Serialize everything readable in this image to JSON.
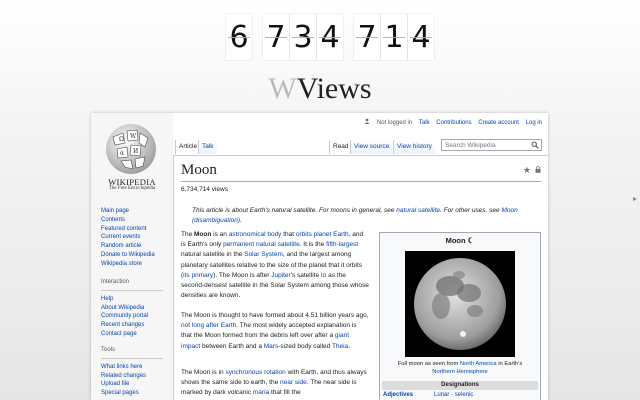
{
  "counter": {
    "digits": [
      "6",
      "7",
      "3",
      "4",
      "7",
      "1",
      "4"
    ]
  },
  "views_label_mark": "W",
  "views_label": "Views",
  "wiki": {
    "wordmark": "WIKIPEDIA",
    "tagline": "The Free Encyclopedia",
    "nav_main": [
      "Main page",
      "Contents",
      "Featured content",
      "Current events",
      "Random article",
      "Donate to Wikipedia",
      "Wikipedia store"
    ],
    "interaction_heading": "Interaction",
    "nav_interaction": [
      "Help",
      "About Wikipedia",
      "Community portal",
      "Recent changes",
      "Contact page"
    ],
    "tools_heading": "Tools",
    "nav_tools": [
      "What links here",
      "Related changes",
      "Upload file",
      "Special pages"
    ],
    "top_links": {
      "not_logged_in": "Not logged in",
      "talk": "Talk",
      "contributions": "Contributions",
      "create_account": "Create account",
      "log_in": "Log in"
    },
    "tabs": {
      "article": "Article",
      "talk": "Talk",
      "read": "Read",
      "view_source": "View source",
      "view_history": "View history"
    },
    "search_placeholder": "Search Wikipedia",
    "page_title": "Moon",
    "view_count": "6,734,714 views",
    "hatnote": {
      "prefix": "This article is about Earth's natural satellite. For moons in general, see ",
      "link1": "natural satellite",
      "middle": ". For other uses, see ",
      "link2": "Moon (disambiguation)",
      "suffix": "."
    },
    "para1": [
      {
        "t": "The "
      },
      {
        "t": "Moon",
        "b": true
      },
      {
        "t": " is an "
      },
      {
        "t": "astronomical body",
        "l": true
      },
      {
        "t": " that "
      },
      {
        "t": "orbits planet Earth",
        "l": true
      },
      {
        "t": ", and is Earth's only "
      },
      {
        "t": "permanent natural satellite",
        "l": true
      },
      {
        "t": ". It is the "
      },
      {
        "t": "fifth-largest",
        "l": true
      },
      {
        "t": " natural satellite in the "
      },
      {
        "t": "Solar System",
        "l": true
      },
      {
        "t": ", and the largest among planetary satellites relative to the size of the planet that it orbits ("
      },
      {
        "t": "its primary",
        "l": true
      },
      {
        "t": "). The Moon is after "
      },
      {
        "t": "Jupiter",
        "l": true
      },
      {
        "t": "'s satellite "
      },
      {
        "t": "Io",
        "l": true
      },
      {
        "t": " as the second-densest satellite in the Solar System among those whose densities are known."
      }
    ],
    "para2": [
      {
        "t": "The Moon is thought to have formed about 4.51 billion years ago, "
      },
      {
        "t": "not long after Earth",
        "l": true
      },
      {
        "t": ". The most widely accepted explanation is that the Moon formed from the debris left over after a "
      },
      {
        "t": "giant impact",
        "l": true
      },
      {
        "t": " between Earth and a "
      },
      {
        "t": "Mars",
        "l": true
      },
      {
        "t": "-sized body called "
      },
      {
        "t": "Theia",
        "l": true
      },
      {
        "t": "."
      }
    ],
    "para3": [
      {
        "t": "The Moon is in "
      },
      {
        "t": "synchronous rotation",
        "l": true
      },
      {
        "t": " with Earth, and thus always shows the same side to earth, the "
      },
      {
        "t": "near side",
        "l": true
      },
      {
        "t": ". The near side is marked by dark volcanic "
      },
      {
        "t": "maria",
        "l": true
      },
      {
        "t": " that fill the"
      }
    ],
    "infobox": {
      "title": "Moon",
      "symbol": "☾",
      "caption_prefix": "Full moon as seen from ",
      "caption_link1": "North America",
      "caption_middle": " in Earth's ",
      "caption_link2": "Northern Hemisphere",
      "section_header": "Designations",
      "row_label": "Adjectives",
      "row_value": "Lunar · selenic"
    }
  },
  "colors": {
    "link": "#0645ad",
    "counter_line": "#d8a857",
    "sidebar_bg": "#f6f6f6"
  }
}
